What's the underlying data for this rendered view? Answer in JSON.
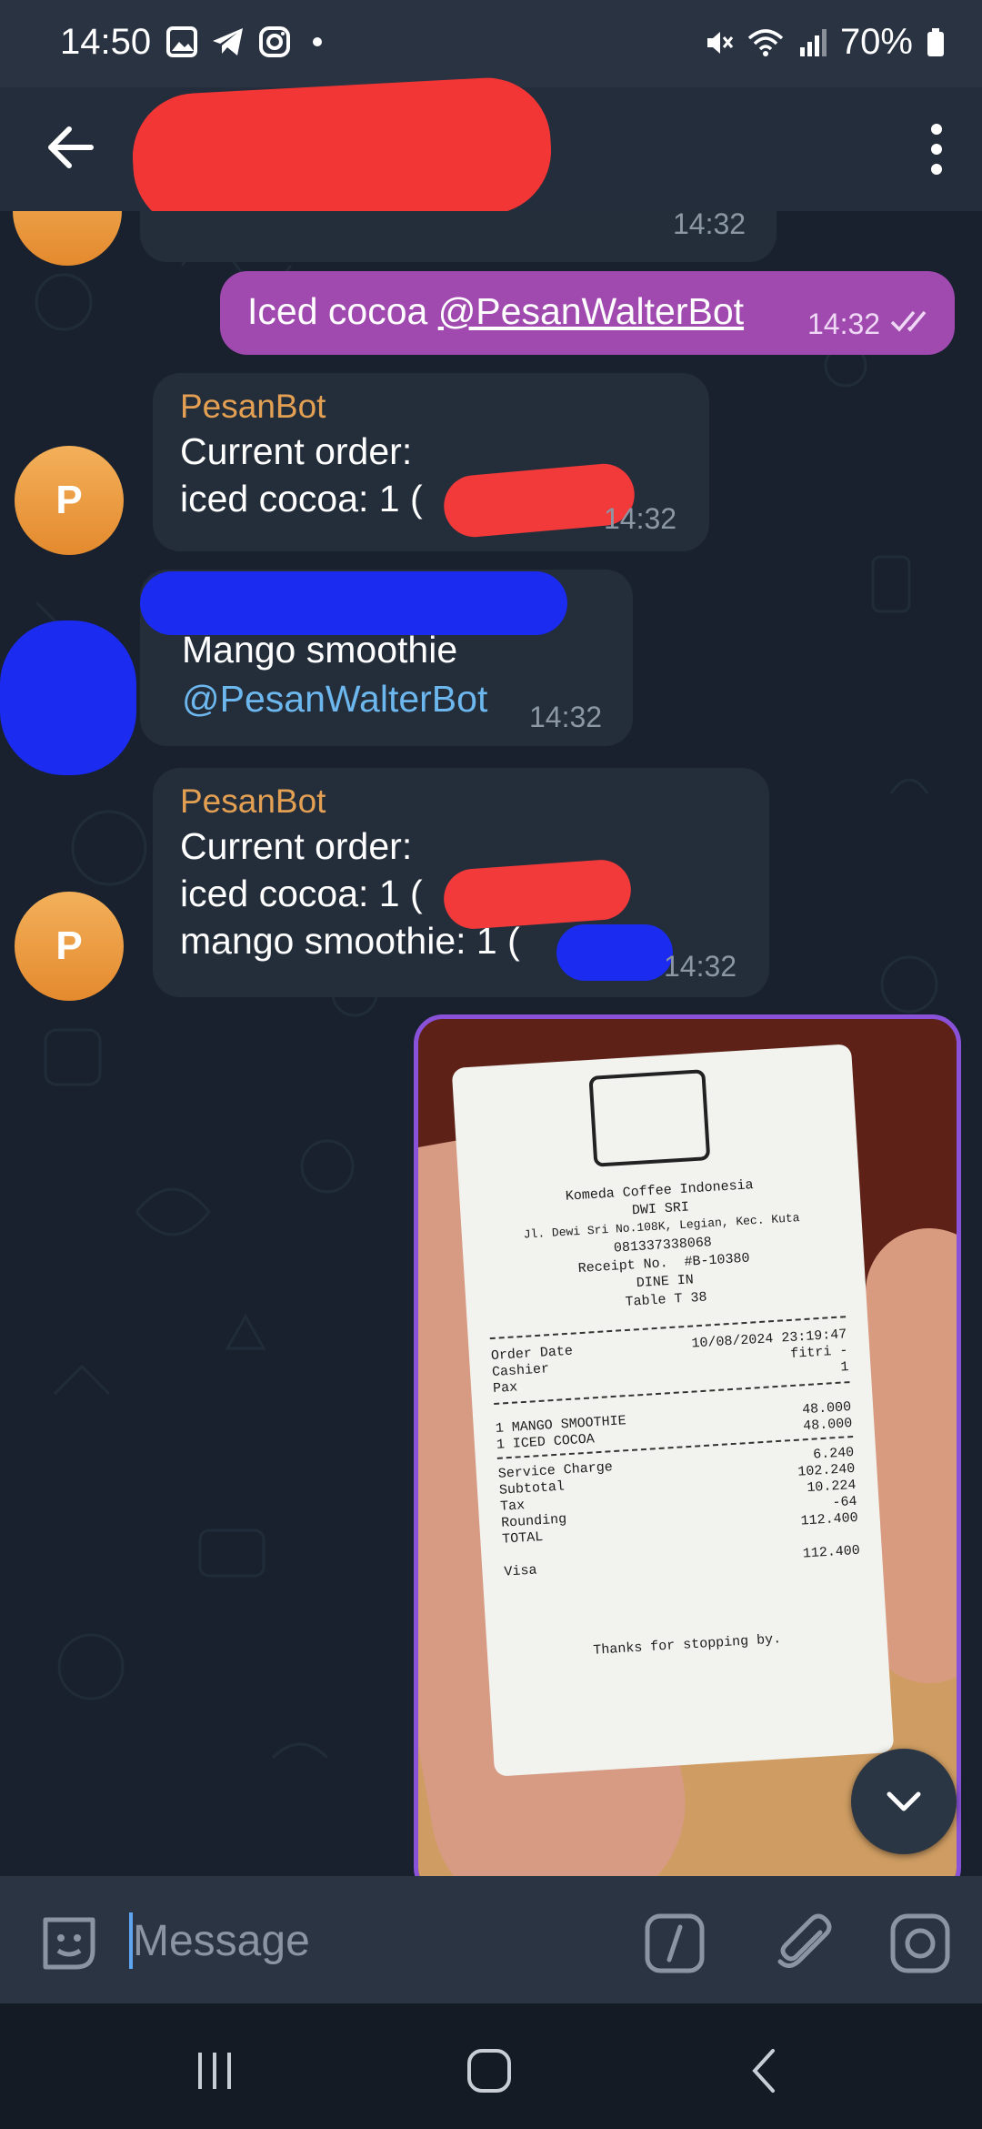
{
  "status": {
    "time": "14:50",
    "battery": "70%"
  },
  "appbar": {
    "title": ""
  },
  "messages": {
    "prev_time": "14:32",
    "out1": {
      "text": "Iced cocoa ",
      "mention": "@PesanWalterBot",
      "time": "14:32"
    },
    "bot1": {
      "sender": "PesanBot",
      "line1": "Current order:",
      "line2": "iced cocoa: 1 (",
      "time": "14:32",
      "avatar": "P"
    },
    "user2": {
      "line1": "Mango smoothie",
      "mention": "@PesanWalterBot",
      "time": "14:32"
    },
    "bot2": {
      "sender": "PesanBot",
      "line1": "Current order:",
      "line2": "iced cocoa: 1 (",
      "line3": "mango smoothie: 1 (",
      "time": "14:32",
      "avatar": "P"
    }
  },
  "receipt": {
    "company": "Komeda Coffee Indonesia",
    "branch": "DWI SRI",
    "address": "Jl. Dewi Sri No.108K, Legian, Kec. Kuta",
    "phone": "081337338068",
    "receipt_no": "Receipt No.  #B-10380",
    "dine": "DINE IN",
    "table": "Table T 38",
    "order_date_label": "Order Date",
    "order_date": "10/08/2024 23:19:47",
    "cashier_label": "Cashier",
    "cashier": "fitri -",
    "pax_label": "Pax",
    "pax": "1",
    "item1": "1 MANGO SMOOTHIE",
    "item1_price": "48.000",
    "item2": "1 ICED COCOA",
    "item2_price": "48.000",
    "service_label": "Service Charge",
    "service": "6.240",
    "subtotal_label": "Subtotal",
    "subtotal": "102.240",
    "tax_label": "Tax",
    "tax": "10.224",
    "rounding_label": "Rounding",
    "rounding": "-64",
    "total_label": "TOTAL",
    "total": "112.400",
    "visa_label": "Visa",
    "visa": "112.400",
    "thanks": "Thanks for stopping by."
  },
  "input": {
    "placeholder": "Message"
  },
  "icons": {
    "back": "arrow-left-icon",
    "more": "more-vert-icon",
    "emoji": "sticker-icon",
    "command": "slash-command-icon",
    "attach": "paperclip-icon",
    "camera": "camera-icon",
    "scroll": "chevron-down-icon"
  },
  "colors": {
    "accent": "#a04ab0",
    "sender": "#e4a052",
    "mention": "#6db7ef",
    "bubble": "#242e3b"
  }
}
